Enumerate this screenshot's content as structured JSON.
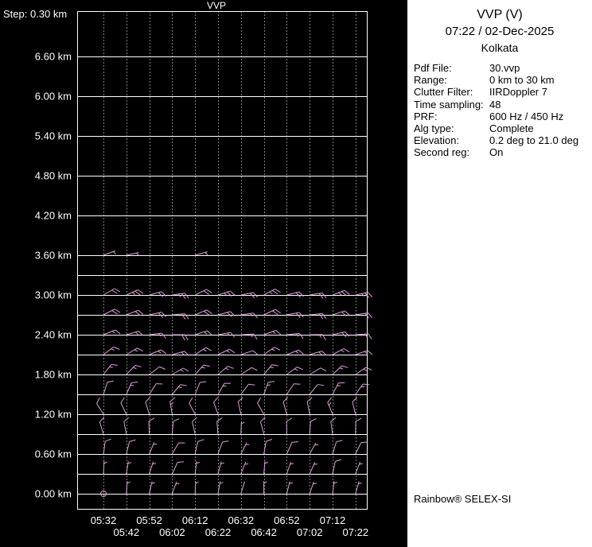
{
  "chart": {
    "title": "VVP",
    "step_label": "Step: 0.30 km",
    "altitude_labels": [
      "6.60 km",
      "6.00 km",
      "5.40 km",
      "4.80 km",
      "4.20 km",
      "3.60 km",
      "3.00 km",
      "2.40 km",
      "1.80 km",
      "1.20 km",
      "0.60 km",
      "0.00 km"
    ],
    "time_labels": [
      "05:32",
      "05:42",
      "05:52",
      "06:02",
      "06:12",
      "06:22",
      "06:32",
      "06:42",
      "06:52",
      "07:02",
      "07:12",
      "07:22"
    ],
    "colors": {
      "background": "#000000",
      "grid": "#ffffff",
      "text": "#ffffff",
      "barb": "#dda0dd",
      "panel_background": "#ffffff",
      "panel_text": "#000000"
    }
  },
  "chart_data": {
    "type": "wind-barb-profile",
    "title": "VVP",
    "x_times": [
      "05:32",
      "05:42",
      "05:52",
      "06:02",
      "06:12",
      "06:22",
      "06:32",
      "06:42",
      "06:52",
      "07:02",
      "07:12",
      "07:22"
    ],
    "y_axis": {
      "min_km": 0.0,
      "max_km": 6.6,
      "label_interval_km": 0.6,
      "step_km": 0.3
    },
    "units": {
      "x": "time HH:MM",
      "y": "km",
      "wind_dir": "deg (wind from)",
      "wind_speed": "kt"
    },
    "barb_format": "[time_index, wind_from_deg, speed_kt]; speed 0 = calm circle; values estimated from plot",
    "rows": [
      {
        "alt_km": 0.0,
        "barbs": [
          [
            0,
            0,
            0
          ],
          [
            1,
            4,
            5
          ],
          [
            2,
            13,
            3
          ],
          [
            3,
            20,
            6
          ],
          [
            4,
            2,
            4
          ],
          [
            5,
            10,
            5
          ],
          [
            6,
            17,
            2
          ],
          [
            7,
            0,
            5
          ],
          [
            8,
            14,
            4
          ],
          [
            9,
            19,
            3
          ],
          [
            10,
            7,
            6
          ],
          [
            11,
            16,
            5
          ]
        ]
      },
      {
        "alt_km": 0.3,
        "barbs": [
          [
            0,
            3,
            6
          ],
          [
            1,
            9,
            7
          ],
          [
            2,
            18,
            5
          ],
          [
            3,
            25,
            8
          ],
          [
            4,
            7,
            6
          ],
          [
            5,
            15,
            7
          ],
          [
            6,
            22,
            4
          ],
          [
            7,
            5,
            7
          ],
          [
            8,
            19,
            6
          ],
          [
            9,
            24,
            5
          ],
          [
            10,
            12,
            8
          ],
          [
            11,
            21,
            7
          ]
        ]
      },
      {
        "alt_km": 0.6,
        "barbs": [
          [
            0,
            8,
            8
          ],
          [
            1,
            14,
            9
          ],
          [
            2,
            23,
            7
          ],
          [
            3,
            30,
            10
          ],
          [
            4,
            12,
            8
          ],
          [
            5,
            20,
            9
          ],
          [
            6,
            27,
            6
          ],
          [
            7,
            10,
            9
          ],
          [
            8,
            24,
            8
          ],
          [
            9,
            29,
            7
          ],
          [
            10,
            17,
            10
          ],
          [
            11,
            26,
            9
          ]
        ]
      },
      {
        "alt_km": 0.9,
        "barbs": [
          [
            0,
            343,
            9
          ],
          [
            1,
            349,
            10
          ],
          [
            2,
            358,
            8
          ],
          [
            3,
            5,
            11
          ],
          [
            4,
            347,
            9
          ],
          [
            5,
            355,
            10
          ],
          [
            6,
            2,
            7
          ],
          [
            7,
            345,
            10
          ],
          [
            8,
            359,
            9
          ],
          [
            9,
            4,
            8
          ],
          [
            10,
            352,
            11
          ],
          [
            11,
            1,
            10
          ]
        ]
      },
      {
        "alt_km": 1.2,
        "barbs": [
          [
            0,
            328,
            11
          ],
          [
            1,
            334,
            12
          ],
          [
            2,
            343,
            10
          ],
          [
            3,
            350,
            13
          ],
          [
            4,
            332,
            11
          ],
          [
            5,
            340,
            12
          ],
          [
            6,
            347,
            9
          ],
          [
            7,
            330,
            12
          ],
          [
            8,
            344,
            11
          ],
          [
            9,
            349,
            10
          ],
          [
            10,
            337,
            13
          ],
          [
            11,
            346,
            12
          ]
        ]
      },
      {
        "alt_km": 1.5,
        "barbs": [
          [
            0,
            18,
            12
          ],
          [
            1,
            24,
            13
          ],
          [
            2,
            33,
            11
          ],
          [
            3,
            40,
            14
          ],
          [
            4,
            22,
            12
          ],
          [
            5,
            30,
            13
          ],
          [
            6,
            37,
            10
          ],
          [
            7,
            20,
            13
          ],
          [
            8,
            34,
            12
          ],
          [
            9,
            39,
            11
          ],
          [
            10,
            27,
            14
          ],
          [
            11,
            36,
            13
          ]
        ]
      },
      {
        "alt_km": 1.8,
        "barbs": [
          [
            0,
            38,
            13
          ],
          [
            1,
            44,
            14
          ],
          [
            2,
            53,
            12
          ],
          [
            3,
            60,
            15
          ],
          [
            4,
            42,
            13
          ],
          [
            5,
            50,
            14
          ],
          [
            6,
            57,
            11
          ],
          [
            7,
            40,
            14
          ],
          [
            8,
            54,
            13
          ],
          [
            9,
            59,
            12
          ],
          [
            10,
            47,
            15
          ],
          [
            11,
            56,
            14
          ]
        ]
      },
      {
        "alt_km": 2.1,
        "barbs": [
          [
            0,
            53,
            14
          ],
          [
            1,
            59,
            15
          ],
          [
            2,
            68,
            13
          ],
          [
            3,
            75,
            16
          ],
          [
            4,
            57,
            14
          ],
          [
            5,
            65,
            15
          ],
          [
            6,
            72,
            12
          ],
          [
            7,
            55,
            15
          ],
          [
            8,
            69,
            14
          ],
          [
            9,
            74,
            13
          ],
          [
            10,
            62,
            16
          ],
          [
            11,
            71,
            15
          ]
        ]
      },
      {
        "alt_km": 2.4,
        "barbs": [
          [
            0,
            68,
            16
          ],
          [
            1,
            74,
            17
          ],
          [
            2,
            83,
            15
          ],
          [
            3,
            90,
            18
          ],
          [
            4,
            72,
            16
          ],
          [
            5,
            80,
            17
          ],
          [
            6,
            87,
            14
          ],
          [
            7,
            70,
            17
          ],
          [
            8,
            84,
            16
          ],
          [
            9,
            89,
            15
          ],
          [
            10,
            77,
            18
          ],
          [
            11,
            86,
            17
          ]
        ]
      },
      {
        "alt_km": 2.7,
        "barbs": [
          [
            0,
            63,
            19
          ],
          [
            1,
            69,
            20
          ],
          [
            2,
            78,
            18
          ],
          [
            3,
            85,
            21
          ],
          [
            4,
            67,
            19
          ],
          [
            5,
            75,
            20
          ],
          [
            6,
            82,
            17
          ],
          [
            7,
            65,
            20
          ],
          [
            8,
            79,
            19
          ],
          [
            9,
            84,
            18
          ],
          [
            10,
            72,
            21
          ],
          [
            11,
            81,
            20
          ]
        ]
      },
      {
        "alt_km": 3.0,
        "barbs": [
          [
            0,
            60,
            22
          ],
          [
            1,
            66,
            23
          ],
          [
            2,
            75,
            21
          ],
          [
            3,
            82,
            24
          ],
          [
            4,
            64,
            22
          ],
          [
            5,
            72,
            23
          ],
          [
            6,
            79,
            20
          ],
          [
            7,
            62,
            23
          ],
          [
            8,
            76,
            22
          ],
          [
            9,
            81,
            21
          ],
          [
            10,
            69,
            24
          ],
          [
            11,
            78,
            23
          ]
        ]
      },
      {
        "alt_km": 3.6,
        "barbs": [
          [
            0,
            70,
            5
          ],
          [
            1,
            78,
            6
          ],
          [
            4,
            74,
            5
          ]
        ]
      }
    ]
  },
  "info_panel": {
    "title": "VVP (V)",
    "datetime": "07:22 / 02-Dec-2025",
    "site": "Kolkata",
    "fields": [
      {
        "label": "Pdf File:",
        "value": "30.vvp"
      },
      {
        "label": "Range:",
        "value": "0 km to 30 km"
      },
      {
        "label": "Clutter Filter:",
        "value": "IIRDoppler 7"
      },
      {
        "label": "Time sampling:",
        "value": "48"
      },
      {
        "label": "PRF:",
        "value": "600 Hz / 450 Hz"
      },
      {
        "label": "Alg type:",
        "value": "Complete"
      },
      {
        "label": "Elevation:",
        "value": "0.2 deg to 21.0 deg"
      },
      {
        "label": "Second reg:",
        "value": "On"
      }
    ],
    "branding": "Rainbow® SELEX-SI"
  }
}
